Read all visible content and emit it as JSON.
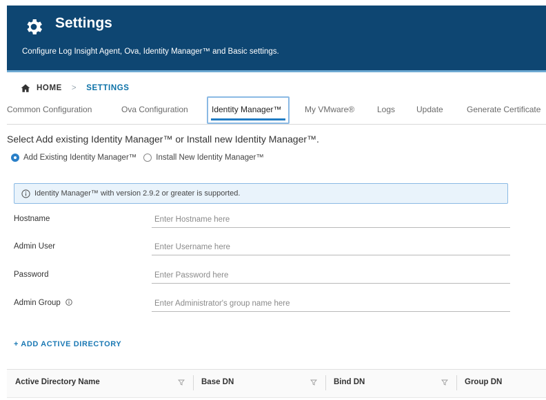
{
  "header": {
    "title": "Settings",
    "subtitle": "Configure Log Insight Agent, Ova, Identity Manager™ and Basic settings.",
    "bg_color": "#0e4672",
    "icon": "gear-icon"
  },
  "breadcrumb": {
    "home": "HOME",
    "separator": ">",
    "current": "SETTINGS"
  },
  "tabs": [
    {
      "label": "Common Configuration",
      "active": false
    },
    {
      "label": "Ova Configuration",
      "active": false
    },
    {
      "label": "Identity Manager™",
      "active": true
    },
    {
      "label": "My VMware®",
      "active": false
    },
    {
      "label": "Logs",
      "active": false
    },
    {
      "label": "Update",
      "active": false
    },
    {
      "label": "Generate Certificate",
      "active": false
    }
  ],
  "instruction": "Select Add existing Identity Manager™ or Install new Identity Manager™.",
  "options": [
    {
      "label": "Add Existing Identity Manager™",
      "selected": true
    },
    {
      "label": "Install New Identity Manager™",
      "selected": false
    }
  ],
  "info_message": "Identity Manager™ with version 2.9.2 or greater is supported.",
  "form": {
    "hostname": {
      "label": "Hostname",
      "placeholder": "Enter Hostname here",
      "value": ""
    },
    "admin_user": {
      "label": "Admin User",
      "placeholder": "Enter Username here",
      "value": ""
    },
    "password": {
      "label": "Password",
      "placeholder": "Enter Password here",
      "value": ""
    },
    "admin_group": {
      "label": "Admin Group",
      "placeholder": "Enter Administrator's group name here",
      "value": ""
    }
  },
  "add_directory_label": "+ ADD ACTIVE DIRECTORY",
  "table": {
    "columns": [
      "Active Directory Name",
      "Base DN",
      "Bind DN",
      "Group DN"
    ]
  },
  "colors": {
    "accent": "#1f7bc3",
    "link": "#0c72a8",
    "info_bg": "#e9f3fb"
  }
}
